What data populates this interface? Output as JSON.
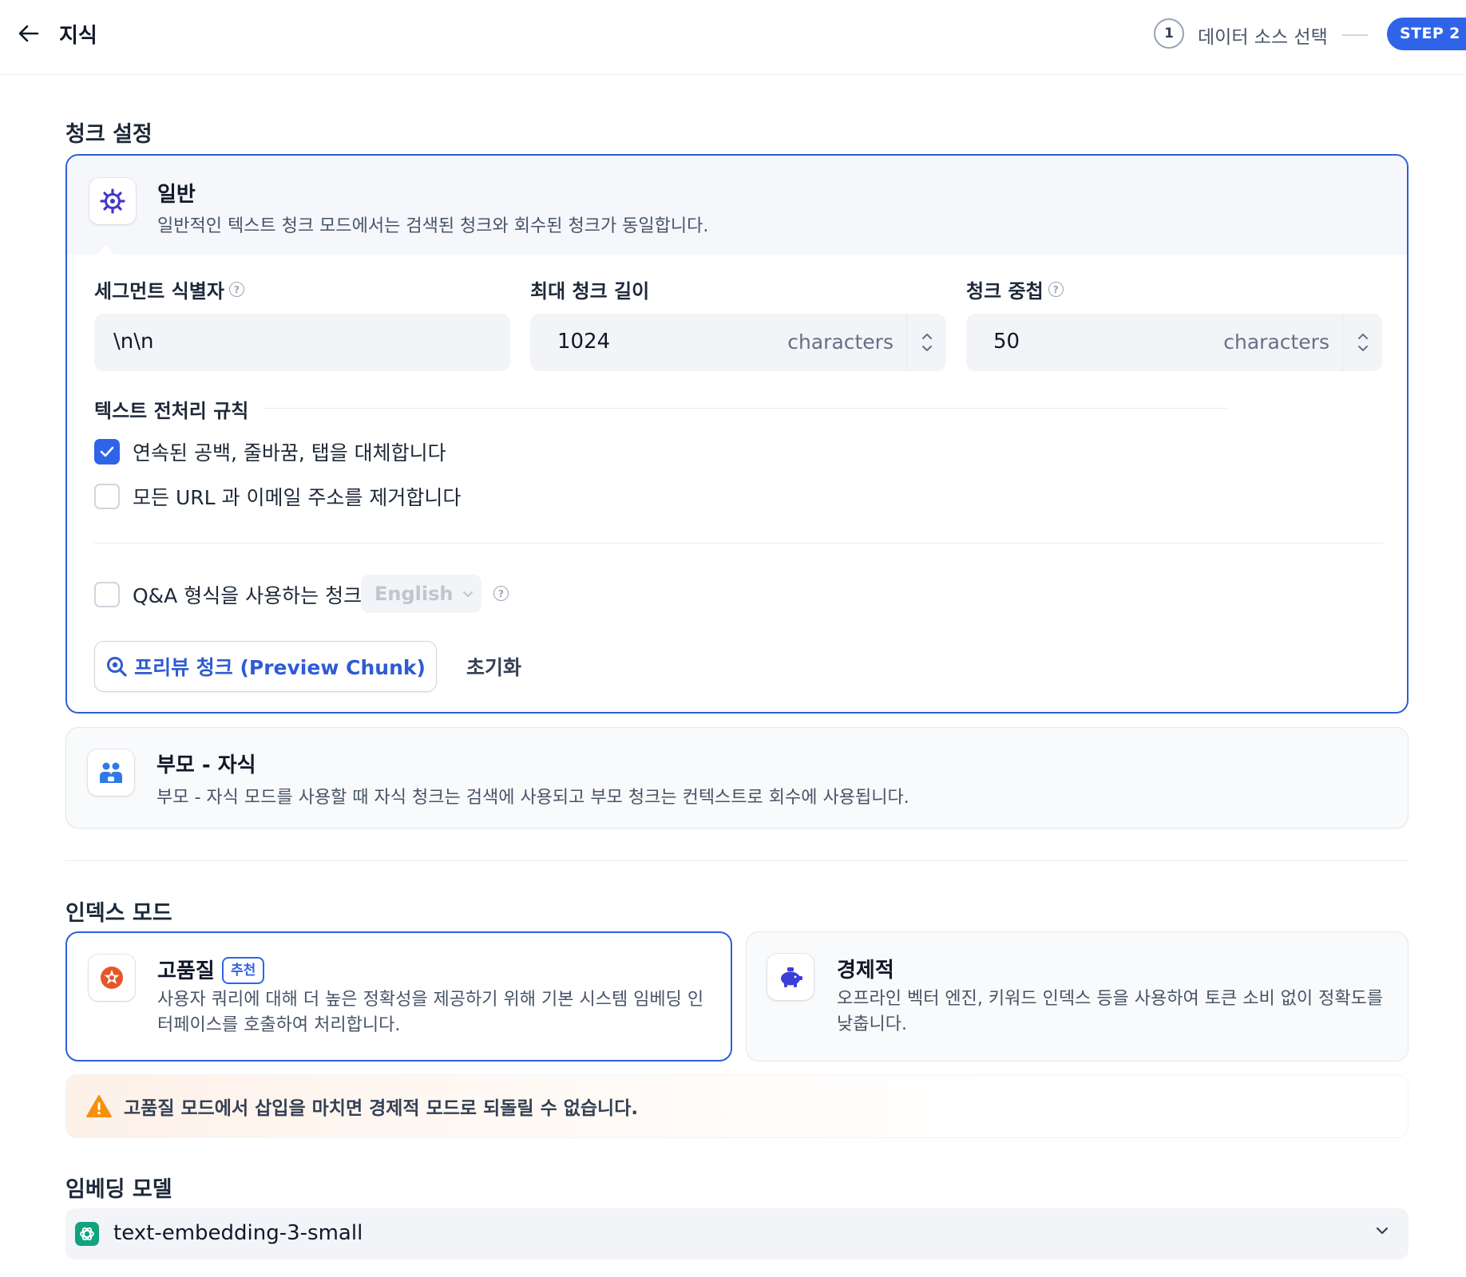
{
  "header": {
    "title": "지식",
    "step1_number": "1",
    "step1_label": "데이터 소스 선택",
    "step2_badge": "STEP 2"
  },
  "chunk_settings": {
    "section_title": "청크 설정",
    "general": {
      "title": "일반",
      "description": "일반적인 텍스트 청크 모드에서는 검색된 청크와 회수된 청크가 동일합니다."
    },
    "segment_identifier": {
      "label": "세그먼트 식별자",
      "value": "\\n\\n"
    },
    "max_chunk_length": {
      "label": "최대 청크 길이",
      "value": "1024",
      "unit": "characters"
    },
    "chunk_overlap": {
      "label": "청크 중첩",
      "value": "50",
      "unit": "characters"
    },
    "preprocessing": {
      "label": "텍스트 전처리 규칙",
      "rules": [
        {
          "label": "연속된 공백, 줄바꿈, 탭을 대체합니다",
          "checked": true
        },
        {
          "label": "모든 URL 과 이메일 주소를 제거합니다",
          "checked": false
        }
      ]
    },
    "qa": {
      "label": "Q&A 형식을 사용하는 청크",
      "checked": false,
      "language": "English"
    },
    "preview_button": "프리뷰 청크 (Preview Chunk)",
    "reset_button": "초기화",
    "parent_child": {
      "title": "부모 - 자식",
      "description": "부모 - 자식 모드를 사용할 때 자식 청크는 검색에 사용되고 부모 청크는 컨텍스트로 회수에 사용됩니다."
    }
  },
  "index_mode": {
    "section_title": "인덱스 모드",
    "high_quality": {
      "title": "고품질",
      "badge": "추천",
      "description": "사용자 쿼리에 대해 더 높은 정확성을 제공하기 위해 기본 시스템 임베딩 인터페이스를 호출하여 처리합니다.",
      "selected": true
    },
    "economy": {
      "title": "경제적",
      "description": "오프라인 벡터 엔진, 키워드 인덱스 등을 사용하여 토큰 소비 없이 정확도를 낮춥니다.",
      "selected": false
    },
    "warning": "고품질 모드에서 삽입을 마치면 경제적 모드로 되돌릴 수 없습니다."
  },
  "embedding": {
    "section_title": "임베딩 모델",
    "model": "text-embedding-3-small"
  },
  "colors": {
    "accent": "#2f64e8",
    "warning": "#f79009",
    "openai": "#10a37f"
  },
  "icons": {
    "back": "arrow-left-icon",
    "general": "gear-icon",
    "parent_child": "users-icon",
    "high_quality": "star-badge-icon",
    "economy": "piggy-bank-icon",
    "warning": "warning-triangle-icon",
    "model": "openai-icon"
  }
}
